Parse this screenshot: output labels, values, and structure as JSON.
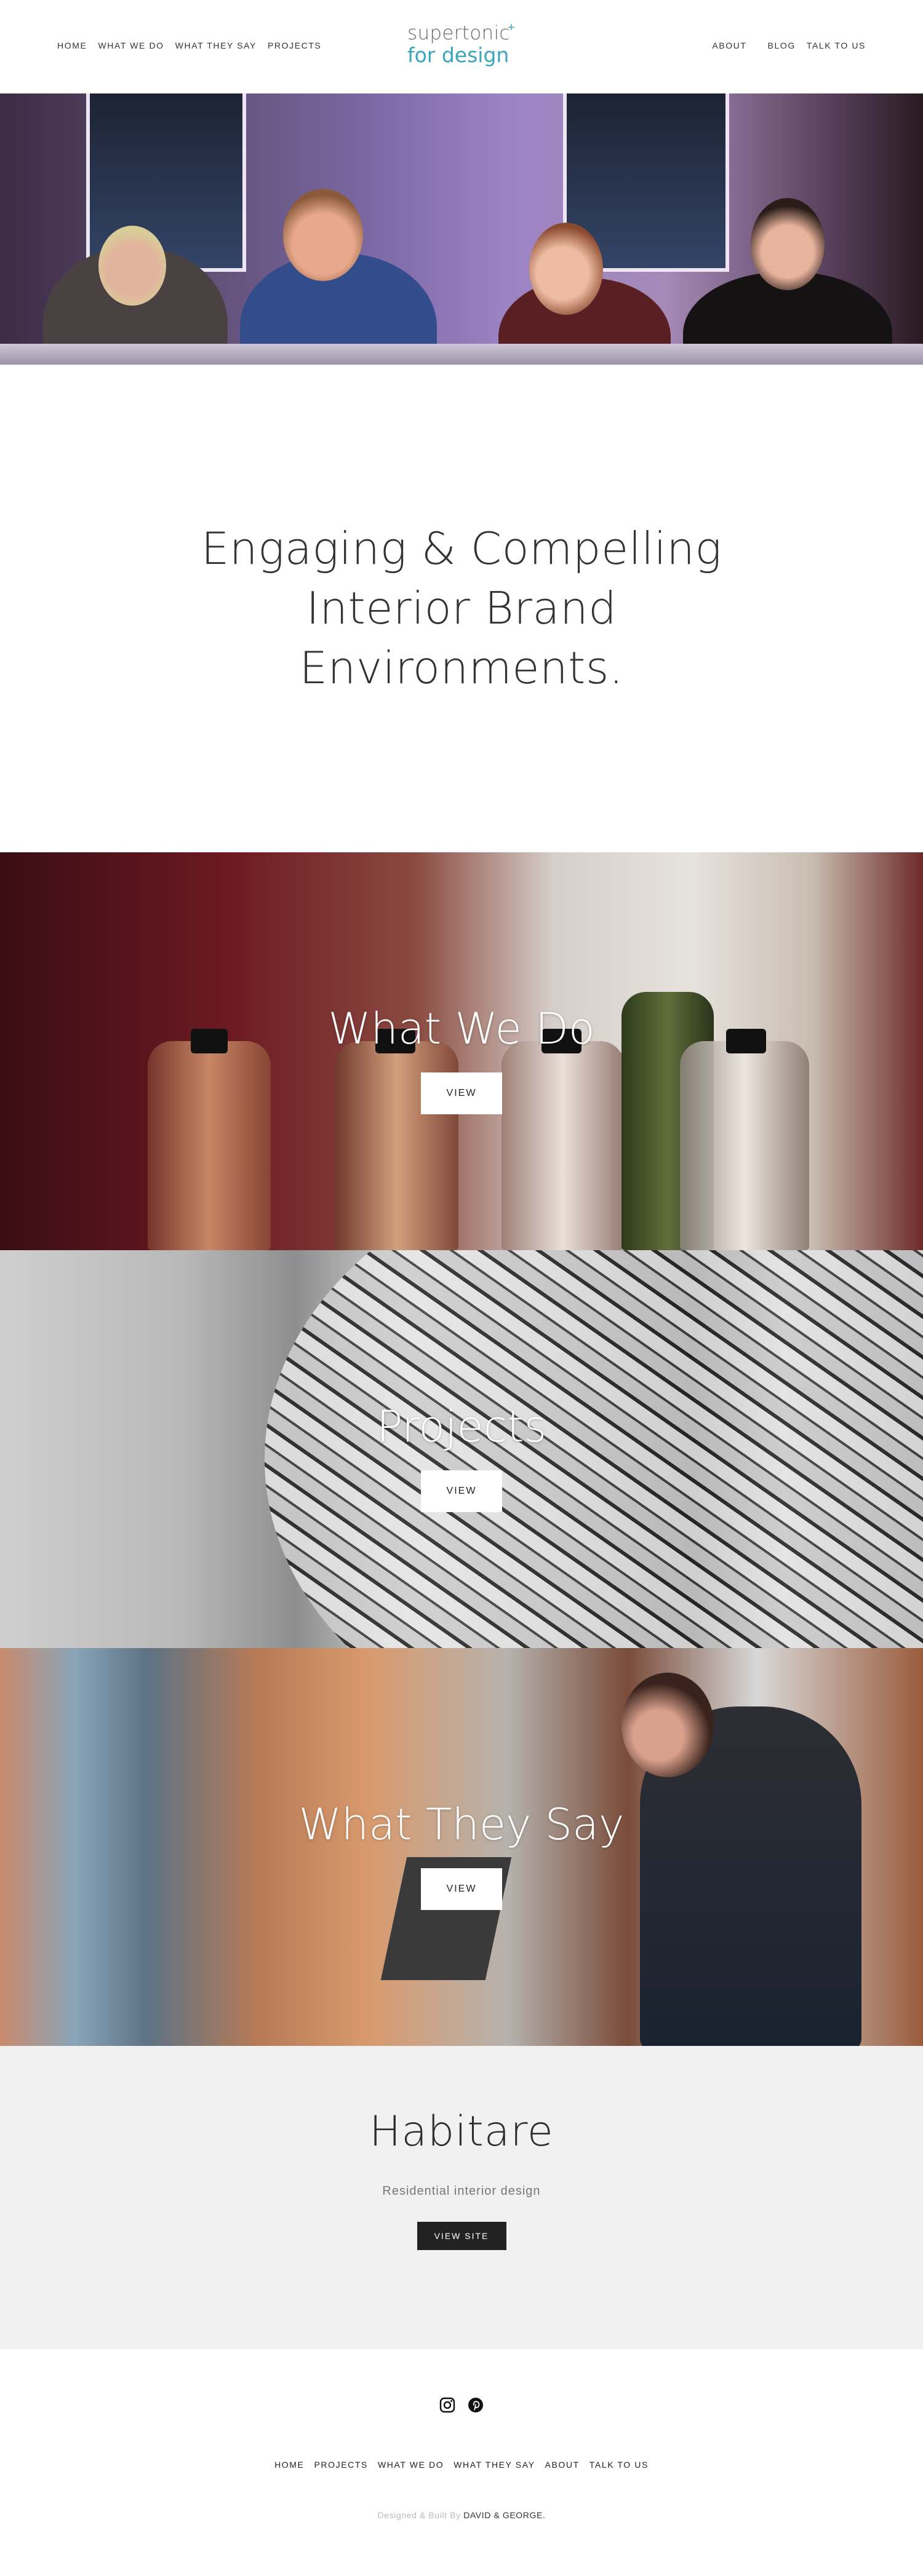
{
  "header": {
    "nav_left": [
      "HOME",
      "WHAT WE DO",
      "WHAT THEY SAY",
      "PROJECTS"
    ],
    "nav_right": [
      "ABOUT",
      "BLOG",
      "TALK TO US"
    ],
    "logo": {
      "line1": "supertonic",
      "plus": "+",
      "line2": "for design"
    }
  },
  "intro": {
    "heading_line1": "Engaging & Compelling",
    "heading_line2": "Interior Brand",
    "heading_line3": "Environments."
  },
  "sections": [
    {
      "title": "What We Do",
      "button": "VIEW"
    },
    {
      "title": "Projects",
      "button": "VIEW"
    },
    {
      "title": "What They Say",
      "button": "VIEW"
    }
  ],
  "habitare": {
    "title": "Habitare",
    "subtitle": "Residential interior design",
    "button": "VIEW SITE"
  },
  "footer": {
    "social": [
      "instagram-icon",
      "pinterest-icon"
    ],
    "nav": [
      "HOME",
      "PROJECTS",
      "WHAT WE DO",
      "WHAT THEY SAY",
      "ABOUT",
      "TALK TO US"
    ],
    "credit_prefix": "Designed & Built By",
    "credit_link": "DAVID & GEORGE."
  },
  "colors": {
    "accent": "#3aa6bd",
    "habitare_bg": "#f1f1f1",
    "dark_button": "#222222"
  }
}
